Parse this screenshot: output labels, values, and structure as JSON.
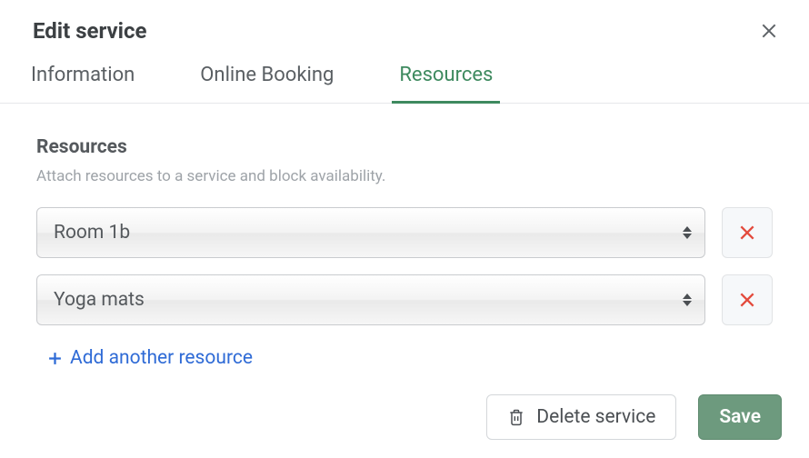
{
  "header": {
    "title": "Edit service"
  },
  "tabs": {
    "information": "Information",
    "online_booking": "Online Booking",
    "resources": "Resources",
    "active": "resources"
  },
  "section": {
    "heading": "Resources",
    "sub": "Attach resources to a service and block availability."
  },
  "rows": [
    {
      "value": "Room 1b"
    },
    {
      "value": "Yoga mats"
    }
  ],
  "add_label": "Add another resource",
  "footer": {
    "delete": "Delete service",
    "save": "Save"
  }
}
